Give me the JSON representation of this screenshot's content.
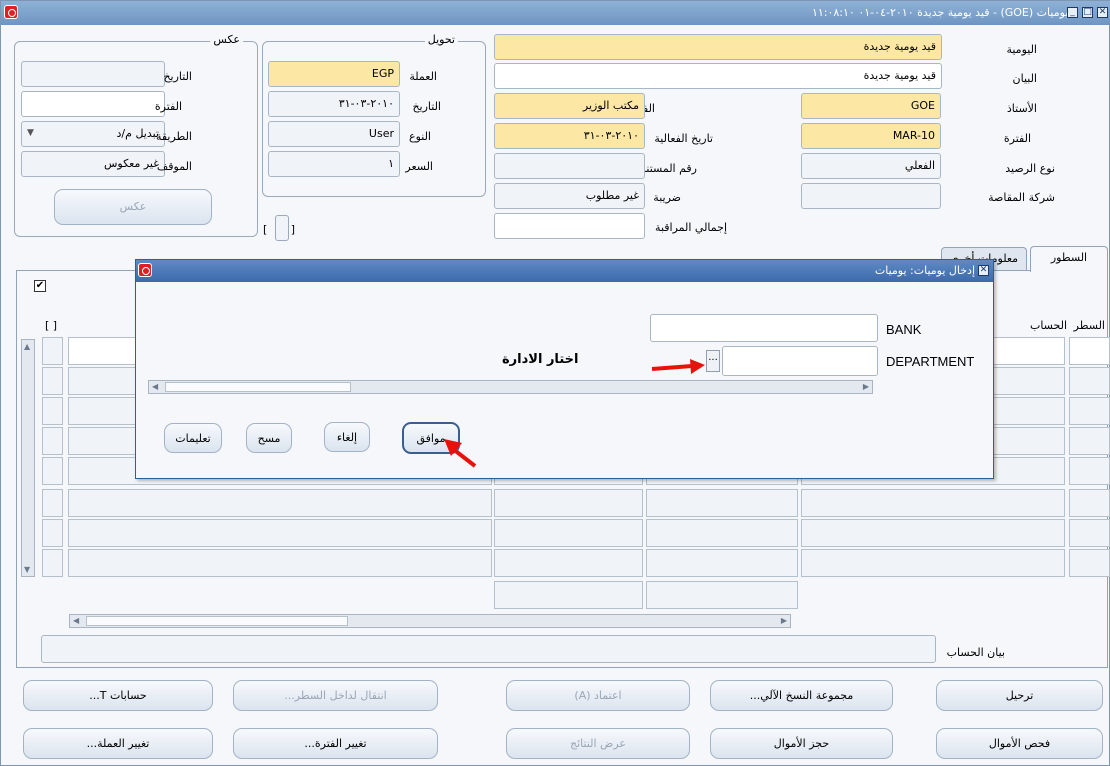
{
  "window": {
    "title": "اليوميات (GOE) - قيد يومية جديدة ٢٠١٠-٠٤-٠١ ١١:٠٨:١٠",
    "close_icon": "close-icon",
    "maximize_icon": "maximize-icon",
    "minimize_icon": "minimize-icon"
  },
  "header": {
    "journal_label": "اليومية",
    "journal_value": "قيد يومية جديدة",
    "description_label": "البيان",
    "description_value": "قيد يومية جديدة",
    "ledger_label": "الأستاذ",
    "ledger_value": "GOE",
    "category_label": "الفئة",
    "category_value": "مكتب الوزير",
    "period_label": "الفترة",
    "period_value": "MAR-10",
    "effective_date_label": "تاريخ الفعالية",
    "effective_date_value": "٢٠١٠-٠٣-٣١",
    "balance_type_label": "نوع الرصيد",
    "balance_type_value": "الفعلي",
    "document_number_label": "رقم المستند",
    "document_number_value": "",
    "clearing_company_label": "شركة المقاصة",
    "tax_label": "ضريبة",
    "tax_value": "غير مطلوب",
    "control_total_label": "إجمالي المراقبة",
    "control_total_value": ""
  },
  "conversion": {
    "title": "تحويل",
    "currency_label": "العملة",
    "currency_value": "EGP",
    "date_label": "التاريخ",
    "date_value": "٢٠١٠-٠٣-٣١",
    "type_label": "النوع",
    "type_value": "User",
    "rate_label": "السعر",
    "rate_value": "١",
    "bracket_text": "[ ]"
  },
  "reverse": {
    "title": "عكس",
    "date_label": "التاريخ",
    "period_label": "الفترة",
    "method_label": "الطريقة",
    "method_value": "تبديل م/د",
    "status_label": "الموقف",
    "status_value": "غير معكوس",
    "reverse_button": "عكس"
  },
  "tabs": [
    {
      "label": "السطور"
    },
    {
      "label": "معلومات أخرى"
    }
  ],
  "lines": {
    "line_col": "السطر",
    "account_col": "الحساب",
    "bracket_text": "[ ]",
    "checked_mark": "✔",
    "account_description_label": "بيان الحساب"
  },
  "dialog": {
    "title": "إدخال يوميات: يوميات",
    "bank_label": "BANK",
    "department_label": "DEPARTMENT",
    "annotation": "اختار الادارة",
    "ellipsis": "...",
    "buttons": {
      "ok": "موافق",
      "cancel": "إلغاء",
      "clear": "مسح",
      "help": "تعليمات"
    }
  },
  "buttons_row1": {
    "post": "ترحيل",
    "autocopy": "مجموعة النسخ الآلي...",
    "approve": "اعتماد (A)",
    "goto_line": "انتقال لداخل السطر...",
    "t_accounts": "حسابات T..."
  },
  "buttons_row2": {
    "check_funds": "فحص الأموال",
    "reserve_funds": "حجز الأموال",
    "view_results": "عرض النتائج",
    "change_period": "تغيير الفترة...",
    "change_currency": "تغيير العملة..."
  }
}
